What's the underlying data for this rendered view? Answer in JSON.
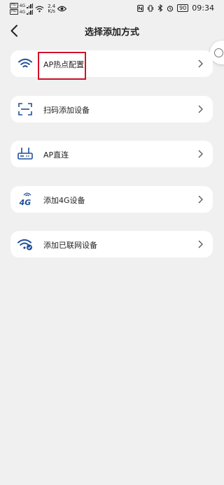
{
  "status_bar": {
    "sim1_tag": "HD",
    "sim2_tag": "HD",
    "network1": "4G",
    "network2": "4G",
    "speed_value": "2.4",
    "speed_unit": "K/s",
    "battery": "90",
    "time": "09:34"
  },
  "header": {
    "title": "选择添加方式"
  },
  "methods": [
    {
      "label": "AP热点配置",
      "icon": "wifi-icon"
    },
    {
      "label": "扫码添加设备",
      "icon": "scan-icon"
    },
    {
      "label": "AP直连",
      "icon": "router-icon"
    },
    {
      "label": "添加4G设备",
      "icon": "4g-icon",
      "icon_text": "4G"
    },
    {
      "label": "添加已联网设备",
      "icon": "wifi-check-icon"
    }
  ],
  "colors": {
    "accent": "#1f4e9a",
    "background": "#f0f0f0",
    "card": "#ffffff",
    "highlight": "#d2102a"
  }
}
